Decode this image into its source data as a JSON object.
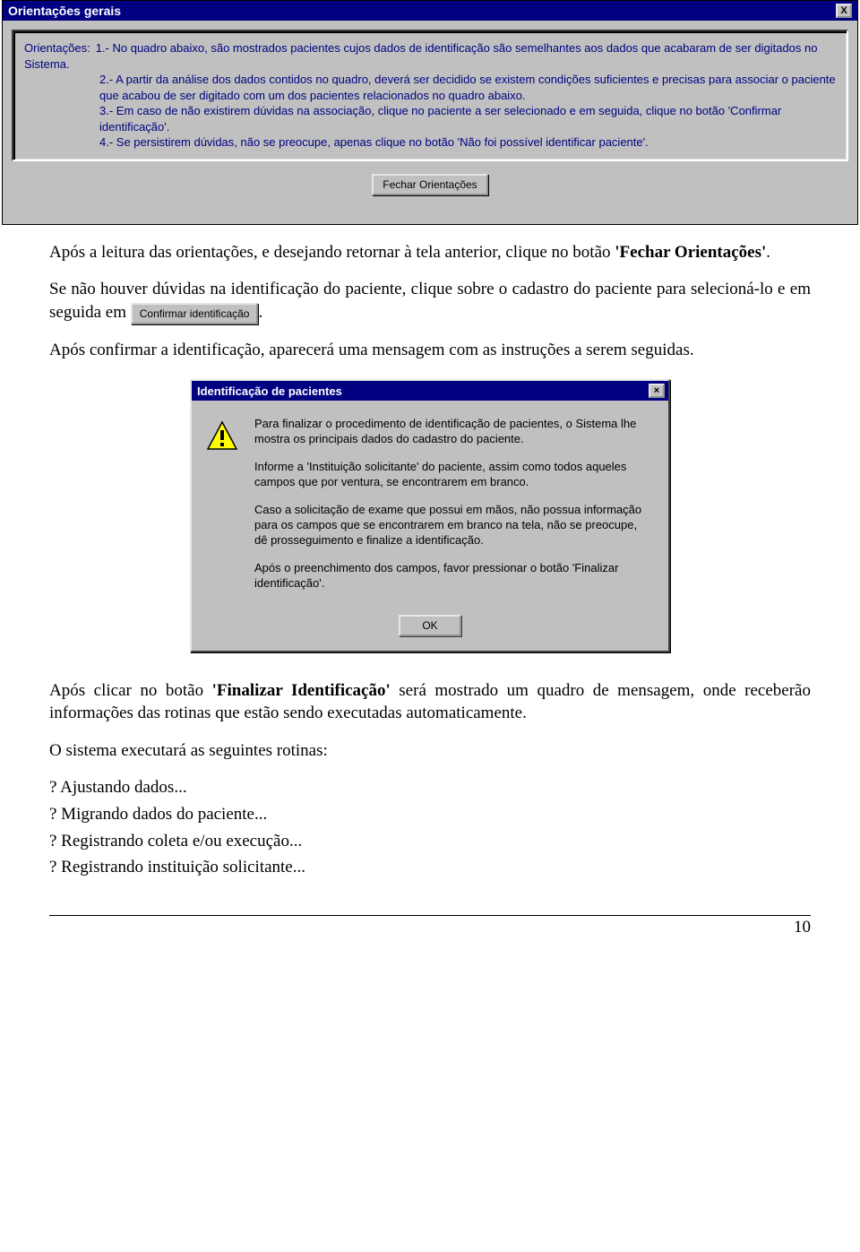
{
  "win1": {
    "title": "Orientações gerais",
    "close": "X",
    "label": "Orientações:",
    "item1": "1.- No quadro abaixo, são mostrados pacientes cujos dados de identificação são semelhantes aos dados que acabaram de ser digitados no Sistema.",
    "item2": "2.- A partir da análise dos dados contidos no quadro, deverá ser decidido se existem condições suficientes e precisas para associar o paciente que acabou de ser digitado com um dos pacientes relacionados no quadro abaixo.",
    "item3": "3.- Em caso de não existirem dúvidas na associação, clique no paciente a ser selecionado e em seguida, clique no botão 'Confirmar identificação'.",
    "item4": "4.- Se persistirem dúvidas, não se preocupe, apenas clique no botão 'Não foi possível identificar paciente'.",
    "button": "Fechar Orientações"
  },
  "doc": {
    "p1a": "Após a leitura das orientações, e desejando retornar à tela anterior, clique no botão ",
    "p1b": "'Fechar Orientações'",
    "p1c": ".",
    "p2a": "Se não houver dúvidas na identificação do paciente, clique sobre o cadastro do paciente para selecioná-lo e em seguida em ",
    "p2btn": "Confirmar identificação",
    "p2b": ".",
    "p3": "Após confirmar a identificação, aparecerá uma mensagem com as instruções a serem seguidas.",
    "p4a": "Após clicar no botão ",
    "p4b": "'Finalizar Identificação'",
    "p4c": " será mostrado um quadro de mensagem, onde receberão informações das rotinas que estão sendo executadas automaticamente.",
    "p5": "O sistema executará as seguintes rotinas:",
    "r1": "? Ajustando dados...",
    "r2": "? Migrando dados do paciente...",
    "r3": "? Registrando coleta e/ou execução...",
    "r4": "? Registrando instituição solicitante..."
  },
  "win2": {
    "title": "Identificação de pacientes",
    "close": "×",
    "p1": "Para finalizar o procedimento de identificação de pacientes, o Sistema lhe mostra os principais dados do cadastro do paciente.",
    "p2": "Informe a 'Instituição solicitante' do paciente, assim como todos aqueles campos que por ventura, se encontrarem em branco.",
    "p3": "Caso a solicitação de exame que possui em mãos, não possua informação para os campos que se encontrarem em branco na tela, não se preocupe, dê prosseguimento e finalize a identificação.",
    "p4": "Após o preenchimento dos campos, favor pressionar o botão 'Finalizar identificação'.",
    "ok": "OK"
  },
  "page_number": "10"
}
